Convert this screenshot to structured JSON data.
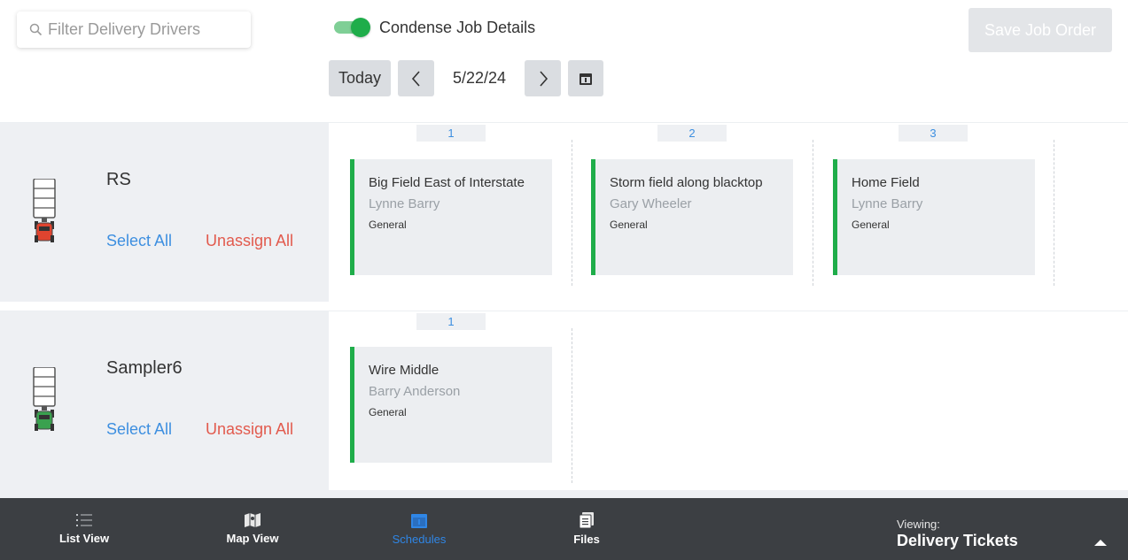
{
  "toolbar": {
    "filter_placeholder": "Filter Delivery Drivers",
    "toggle_label": "Condense Job Details",
    "toggle_on": true,
    "today_label": "Today",
    "date": "5/22/24",
    "save_label": "Save Job Order"
  },
  "drivers": [
    {
      "name": "RS",
      "select_all": "Select All",
      "unassign_all": "Unassign All",
      "truck_color": "#e0442f",
      "columns": [
        "1",
        "2",
        "3"
      ],
      "jobs": [
        {
          "title": "Big Field East of Interstate",
          "person": "Lynne Barry",
          "type": "General"
        },
        {
          "title": "Storm field along blacktop",
          "person": "Gary Wheeler",
          "type": "General"
        },
        {
          "title": "Home Field",
          "person": "Lynne Barry",
          "type": "General"
        }
      ]
    },
    {
      "name": "Sampler6",
      "select_all": "Select All",
      "unassign_all": "Unassign All",
      "truck_color": "#3aa14f",
      "columns": [
        "1"
      ],
      "jobs": [
        {
          "title": "Wire Middle",
          "person": "Barry Anderson",
          "type": "General"
        }
      ]
    }
  ],
  "bottom_nav": {
    "tabs": [
      {
        "label": "List View",
        "icon": "list-icon"
      },
      {
        "label": "Map View",
        "icon": "map-icon"
      },
      {
        "label": "Schedules",
        "icon": "calendar-icon",
        "active": true
      },
      {
        "label": "Files",
        "icon": "files-icon"
      }
    ],
    "viewing_label": "Viewing:",
    "viewing_value": "Delivery Tickets"
  },
  "colors": {
    "accent_green": "#1fad4a",
    "link_blue": "#3d8fe0",
    "danger_red": "#e25a4d",
    "bottom_bar": "#3c3f43"
  }
}
